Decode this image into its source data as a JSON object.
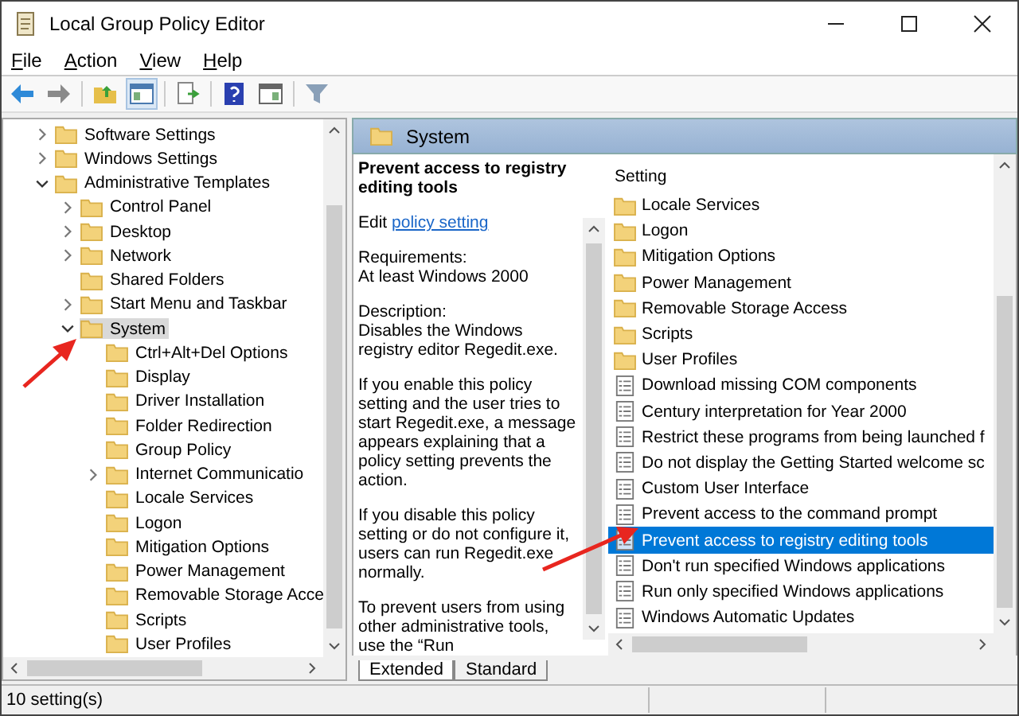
{
  "window": {
    "title": "Local Group Policy Editor"
  },
  "menu": [
    "File",
    "Action",
    "View",
    "Help"
  ],
  "tree": [
    {
      "label": "Software Settings",
      "expandable": true,
      "expanded": false,
      "selected": false
    },
    {
      "label": "Windows Settings",
      "expandable": true,
      "expanded": false,
      "selected": false
    },
    {
      "label": "Administrative Templates",
      "expandable": true,
      "expanded": true,
      "selected": false,
      "children": [
        {
          "label": "Control Panel",
          "expandable": true,
          "expanded": false,
          "selected": false
        },
        {
          "label": "Desktop",
          "expandable": true,
          "expanded": false,
          "selected": false
        },
        {
          "label": "Network",
          "expandable": true,
          "expanded": false,
          "selected": false
        },
        {
          "label": "Shared Folders",
          "expandable": false,
          "expanded": false,
          "selected": false
        },
        {
          "label": "Start Menu and Taskbar",
          "expandable": true,
          "expanded": false,
          "selected": false
        },
        {
          "label": "System",
          "expandable": true,
          "expanded": true,
          "selected": true,
          "children": [
            {
              "label": "Ctrl+Alt+Del Options",
              "expandable": false,
              "expanded": false,
              "selected": false
            },
            {
              "label": "Display",
              "expandable": false,
              "expanded": false,
              "selected": false
            },
            {
              "label": "Driver Installation",
              "expandable": false,
              "expanded": false,
              "selected": false
            },
            {
              "label": "Folder Redirection",
              "expandable": false,
              "expanded": false,
              "selected": false
            },
            {
              "label": "Group Policy",
              "expandable": false,
              "expanded": false,
              "selected": false
            },
            {
              "label": "Internet Communicatio",
              "expandable": true,
              "expanded": false,
              "selected": false
            },
            {
              "label": "Locale Services",
              "expandable": false,
              "expanded": false,
              "selected": false
            },
            {
              "label": "Logon",
              "expandable": false,
              "expanded": false,
              "selected": false
            },
            {
              "label": "Mitigation Options",
              "expandable": false,
              "expanded": false,
              "selected": false
            },
            {
              "label": "Power Management",
              "expandable": false,
              "expanded": false,
              "selected": false
            },
            {
              "label": "Removable Storage Acce",
              "expandable": false,
              "expanded": false,
              "selected": false
            },
            {
              "label": "Scripts",
              "expandable": false,
              "expanded": false,
              "selected": false
            },
            {
              "label": "User Profiles",
              "expandable": false,
              "expanded": false,
              "selected": false
            }
          ]
        }
      ]
    }
  ],
  "header": {
    "title": "System"
  },
  "description": {
    "title": "Prevent access to registry editing tools",
    "edit_prefix": "Edit",
    "edit_link": "policy setting",
    "paragraphs": [
      "Requirements:\nAt least Windows 2000",
      "Description:\nDisables the Windows registry editor Regedit.exe.",
      "If you enable this policy setting and the user tries to start Regedit.exe, a message appears explaining that a policy setting prevents the action.",
      "If you disable this policy setting or do not configure it, users can run Regedit.exe normally.",
      "To prevent users from using other administrative tools, use the “Run"
    ]
  },
  "list": {
    "column": "Setting",
    "items": [
      {
        "label": "Locale Services",
        "kind": "folder",
        "selected": false
      },
      {
        "label": "Logon",
        "kind": "folder",
        "selected": false
      },
      {
        "label": "Mitigation Options",
        "kind": "folder",
        "selected": false
      },
      {
        "label": "Power Management",
        "kind": "folder",
        "selected": false
      },
      {
        "label": "Removable Storage Access",
        "kind": "folder",
        "selected": false
      },
      {
        "label": "Scripts",
        "kind": "folder",
        "selected": false
      },
      {
        "label": "User Profiles",
        "kind": "folder",
        "selected": false
      },
      {
        "label": "Download missing COM components",
        "kind": "setting",
        "selected": false
      },
      {
        "label": "Century interpretation for Year 2000",
        "kind": "setting",
        "selected": false
      },
      {
        "label": "Restrict these programs from being launched f",
        "kind": "setting",
        "selected": false
      },
      {
        "label": "Do not display the Getting Started welcome sc",
        "kind": "setting",
        "selected": false
      },
      {
        "label": "Custom User Interface",
        "kind": "setting",
        "selected": false
      },
      {
        "label": "Prevent access to the command prompt",
        "kind": "setting",
        "selected": false
      },
      {
        "label": "Prevent access to registry editing tools",
        "kind": "setting",
        "selected": true
      },
      {
        "label": "Don't run specified Windows applications",
        "kind": "setting",
        "selected": false
      },
      {
        "label": "Run only specified Windows applications",
        "kind": "setting",
        "selected": false
      },
      {
        "label": "Windows Automatic Updates",
        "kind": "setting",
        "selected": false
      }
    ]
  },
  "tabs": [
    {
      "label": "Extended",
      "selected": true
    },
    {
      "label": "Standard",
      "selected": false
    }
  ],
  "status_bar": {
    "text": "10 setting(s)"
  }
}
